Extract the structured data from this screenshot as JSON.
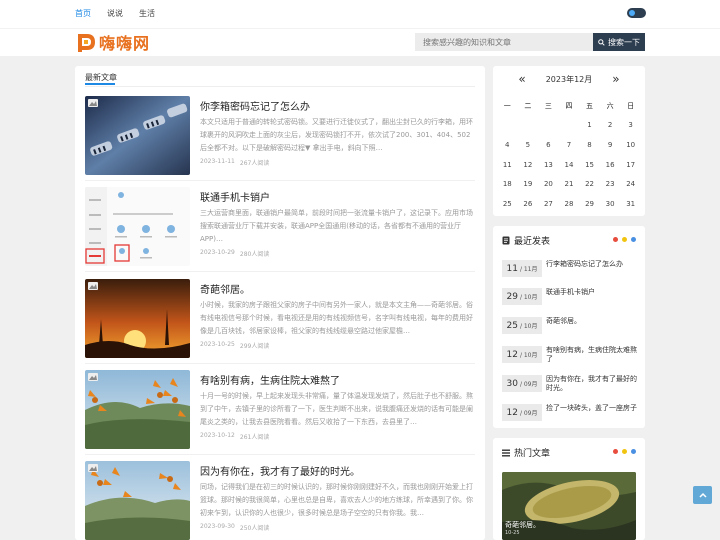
{
  "topnav": {
    "items": [
      "首页",
      "说说",
      "生活"
    ]
  },
  "header": {
    "logo_text": "嗨嗨网",
    "search_placeholder": "搜索感兴趣的知识和文章",
    "search_button": "搜索一下"
  },
  "main": {
    "title": "最新文章",
    "articles": [
      {
        "title": "你李箱密码忘记了怎么办",
        "excerpt": "本文只适用于普通的转轮式密码锁。又要进行迁徙仪式了，翻出尘封已久的行李箱，用环球裹开的风洞吹走上面的灰尘后，发现密码锁打不开，依次试了200、301、404、502后全都不对。以下是破解密码过程▼ 拿出手电，斜向下照…",
        "date": "2023-11-11",
        "views": "267人阅读"
      },
      {
        "title": "联通手机卡销户",
        "excerpt": "三大运营商里面，联通销户最简单，前段时间把一张流量卡销户了，这记录下。应用市场搜索联通营业厅下载并安装，联通APP全国通用(移动的话，各省都有不通用的营业厅APP)…",
        "date": "2023-10-29",
        "views": "280人阅读"
      },
      {
        "title": "奇葩邻居。",
        "excerpt": "小时候，我家的房子跟祖父家的房子中间有另外一家人，就是本文主角——奇葩邻居。俗有线电视信号那个时候，看电视还是用的有线视频信号，名字叫有线电视，每年的费用好像是几百块钱，邻居家设棒，祖父家的有线线缆悬空路过他家屋檐…",
        "date": "2023-10-25",
        "views": "299人阅读"
      },
      {
        "title": "有啥别有病，生病住院太难熬了",
        "excerpt": "十月一号的时候，早上起来发现头非常痛，量了体温发现发烧了，然后肚子也不舒服。熬到了中午，去镇子里的诊所看了一下，医生判断不出来，说我腹痛还发烧的话有可能是阑尾炎之类的，让我去县医院看看。然后又收拾了一下东西，去县里了…",
        "date": "2023-10-12",
        "views": "261人阅读"
      },
      {
        "title": "因为有你在，我才有了最好的时光。",
        "excerpt": "同场，记得我们是在初三的时候认识的，那时候你刚刚建好不久，而我也刚刚开始爱上打篮球。那时候的我很简单，心里也总是自卑，喜欢去人少的地方练球，所幸遇到了你。你初来乍到，认识你的人也很少，很多时候总是场子空空的只有你我。我…",
        "date": "2023-09-30",
        "views": "250人阅读"
      }
    ]
  },
  "calendar": {
    "month_label": "2023年12月",
    "prev": "«",
    "next": "»",
    "weekdays": [
      "一",
      "二",
      "三",
      "四",
      "五",
      "六",
      "日"
    ],
    "weeks": [
      [
        "",
        "",
        "",
        "",
        "1",
        "2",
        "3"
      ],
      [
        "4",
        "5",
        "6",
        "7",
        "8",
        "9",
        "10"
      ],
      [
        "11",
        "12",
        "13",
        "14",
        "15",
        "16",
        "17"
      ],
      [
        "18",
        "19",
        "20",
        "21",
        "22",
        "23",
        "24"
      ],
      [
        "25",
        "26",
        "27",
        "28",
        "29",
        "30",
        "31"
      ]
    ]
  },
  "latest": {
    "title": "最近发表",
    "items": [
      {
        "day": "11",
        "month": "/ 11月",
        "title": "行李箱密码忘记了怎么办"
      },
      {
        "day": "29",
        "month": "/ 10月",
        "title": "联通手机卡销户"
      },
      {
        "day": "25",
        "month": "/ 10月",
        "title": "奇葩邻居。"
      },
      {
        "day": "12",
        "month": "/ 10月",
        "title": "有啥别有病，生病住院太难熬了"
      },
      {
        "day": "30",
        "month": "/ 09月",
        "title": "因为有你在，我才有了最好的时光。"
      },
      {
        "day": "12",
        "month": "/ 09月",
        "title": "捡了一块砖头，盖了一座房子"
      }
    ]
  },
  "hot": {
    "title": "热门文章",
    "caption": "奇葩邻居。",
    "meta": "10-25"
  },
  "colors": {
    "accent": "#1e88e5",
    "dot_red": "#e74c3c",
    "dot_yellow": "#f1c40f",
    "dot_blue": "#4a90e2",
    "search_button_bg": "#2d3e50"
  }
}
